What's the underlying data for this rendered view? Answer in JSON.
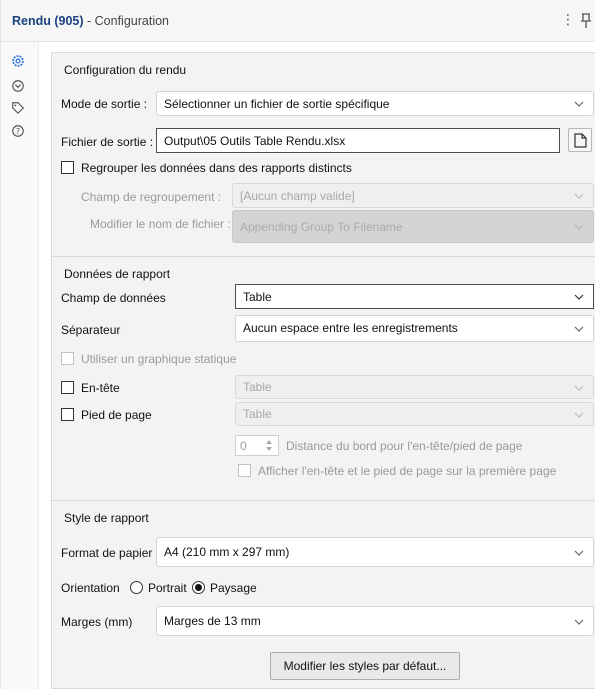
{
  "window": {
    "tool_name": "Rendu (905)",
    "separator": " - ",
    "subtitle": "Configuration",
    "more_icon": "kebab-menu-icon",
    "pin_icon": "pin-icon"
  },
  "side_rail": {
    "icons": [
      "gear-icon",
      "target-icon",
      "tag-icon",
      "help-icon"
    ]
  },
  "config_rendu": {
    "title": "Configuration du rendu",
    "mode_label": "Mode de sortie :",
    "mode_value": "Sélectionner un fichier de sortie spécifique",
    "file_label": "Fichier de sortie :",
    "file_value": "Output\\05 Outils Table Rendu.xlsx",
    "group_checkbox_label": "Regrouper les données dans des rapports distincts",
    "group_checked": false,
    "group_field_label": "Champ de regroupement :",
    "group_field_value": "[Aucun champ valide]",
    "rename_label": "Modifier le nom de fichier :",
    "rename_value": "Appending Group To Filename"
  },
  "report_data": {
    "title": "Données de rapport",
    "data_field_label": "Champ de données",
    "data_field_value": "Table",
    "separator_label": "Séparateur",
    "separator_value": "Aucun espace entre les enregistrements",
    "static_chart_label": "Utiliser un graphique statique",
    "header_label": "En-tête",
    "header_value": "Table",
    "footer_label": "Pied de page",
    "footer_value": "Table",
    "distance_value": "0",
    "distance_label": "Distance du bord pour l'en-tête/pied de page",
    "first_page_label": "Afficher l'en-tête et le pied de page sur la première page"
  },
  "report_style": {
    "title": "Style de rapport",
    "paper_label": "Format de papier",
    "paper_value": "A4 (210 mm x 297 mm)",
    "orientation_label": "Orientation",
    "portrait_label": "Portrait",
    "landscape_label": "Paysage",
    "orientation_selected": "Paysage",
    "margins_label": "Marges (mm)",
    "margins_value": "Marges de 13 mm",
    "defaults_button": "Modifier les styles par défaut..."
  },
  "colors": {
    "accent": "#19407f",
    "panel_bg": "#f3f3f3",
    "disabled_text": "#9a9a9a"
  }
}
